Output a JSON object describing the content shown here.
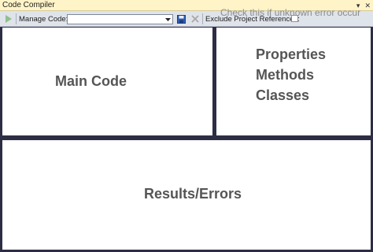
{
  "window": {
    "title": "Code Compiler",
    "buttons": [
      "pin-icon",
      "close-icon"
    ]
  },
  "toolbar": {
    "run_icon": "play-icon",
    "manage_code_label": "Manage Code:",
    "manage_code_value": "",
    "save_icon": "save-icon",
    "delete_icon": "delete-icon",
    "exclude_label": "Exclude Project References:",
    "exclude_checked": false,
    "hint": "Check this if unknown error occur"
  },
  "panels": {
    "main_code": "Main Code",
    "properties": [
      "Properties",
      "Methods",
      "Classes"
    ],
    "results": "Results/Errors"
  },
  "colors": {
    "title_bar": "#fff4c8",
    "toolbar": "#dfe3ea",
    "frame": "#2d2d44",
    "panel_text": "#555555"
  }
}
